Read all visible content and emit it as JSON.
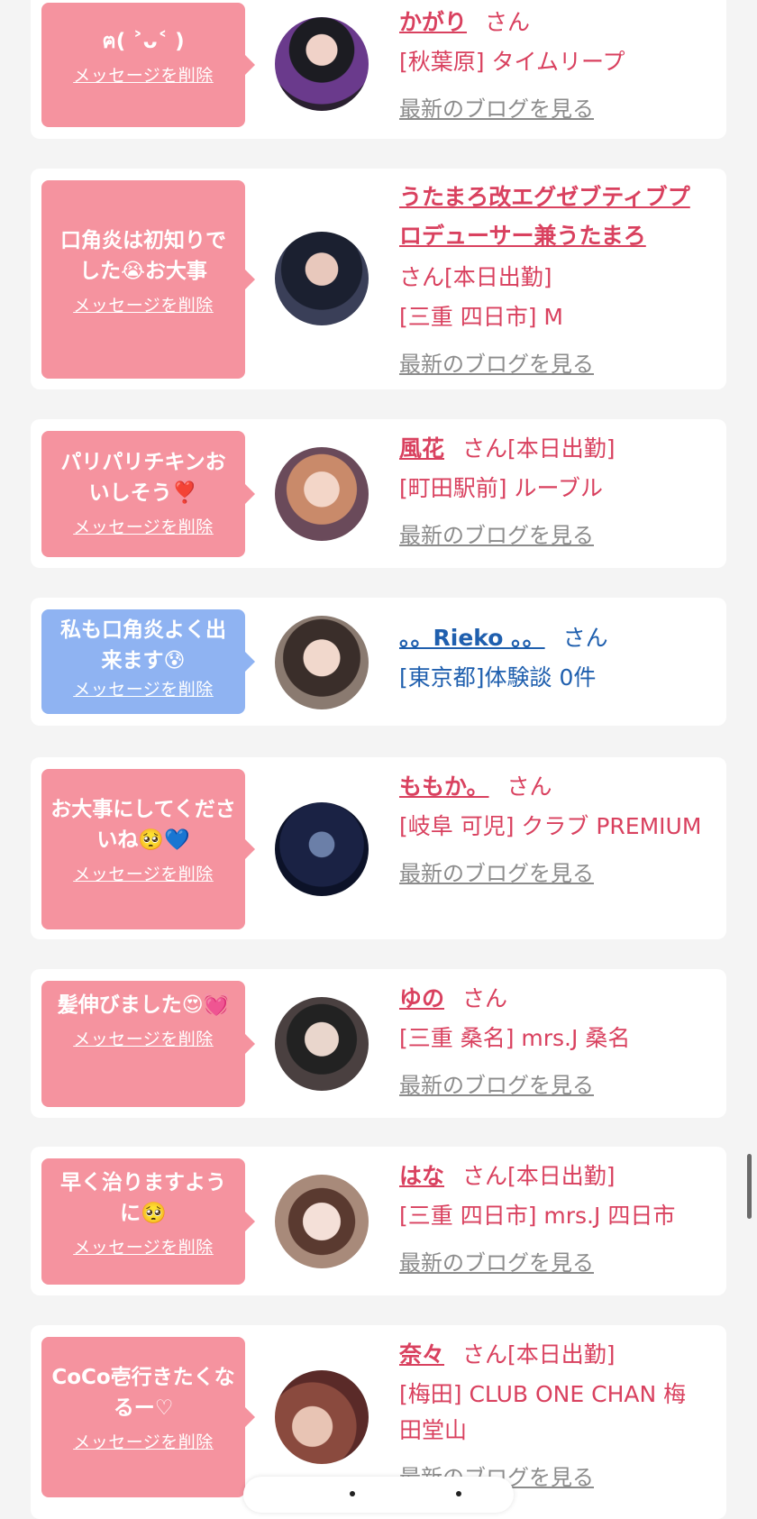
{
  "messages": [
    {
      "text": "ฅ( ˃ᴗ˂ )",
      "delete": "メッセージを削除",
      "name": "かがり",
      "san": "さん",
      "shift": "",
      "location": "[秋葉原] タイムリープ",
      "blog": "最新のブログを見る",
      "color": "pink"
    },
    {
      "text": "口角炎は初知りでした😭お大事",
      "delete": "メッセージを削除",
      "name": "うたまろ改エグゼブティブプロデューサー兼うたまろ",
      "san": "さん",
      "shift": "[本日出勤]",
      "location": "[三重 四日市] M",
      "blog": "最新のブログを見る",
      "color": "pink"
    },
    {
      "text": "パリパリチキンおいしそう❣️",
      "delete": "メッセージを削除",
      "name": "風花",
      "san": "さん",
      "shift": "[本日出勤]",
      "location": "[町田駅前] ルーブル",
      "blog": "最新のブログを見る",
      "color": "pink"
    },
    {
      "text": "私も口角炎よく出来ます😰",
      "delete": "メッセージを削除",
      "name": "。。Rieko 。。",
      "san": "さん",
      "shift": "",
      "location": "[東京都]体験談 0件",
      "blog": "",
      "color": "blue"
    },
    {
      "text": "お大事にしてくださいね🥺💙",
      "delete": "メッセージを削除",
      "name": "ももか。",
      "san": "さん",
      "shift": "",
      "location": "[岐阜 可児] クラブ PREMIUM",
      "blog": "最新のブログを見る",
      "color": "pink"
    },
    {
      "text": "髪伸びました😍💓",
      "delete": "メッセージを削除",
      "name": "ゆの",
      "san": "さん",
      "shift": "",
      "location": "[三重 桑名] mrs.J 桑名",
      "blog": "最新のブログを見る",
      "color": "pink"
    },
    {
      "text": "早く治りますように🥺",
      "delete": "メッセージを削除",
      "name": "はな",
      "san": "さん",
      "shift": "[本日出勤]",
      "location": "[三重 四日市] mrs.J 四日市",
      "blog": "最新のブログを見る",
      "color": "pink"
    },
    {
      "text": "CoCo壱行きたくなるー♡",
      "delete": "メッセージを削除",
      "name": "奈々",
      "san": "さん",
      "shift": "[本日出勤]",
      "location": "[梅田] CLUB ONE CHAN 梅田堂山",
      "blog": "最新のブログを見る",
      "color": "pink"
    }
  ],
  "colors": {
    "pink": "#f5939f",
    "blue": "#8fb3f2",
    "name": "#d9415f",
    "link_blue": "#1f5fae"
  }
}
